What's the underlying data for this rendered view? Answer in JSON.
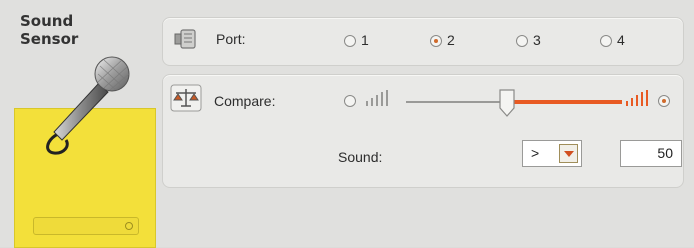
{
  "sensor": {
    "title": "Sound\nSensor",
    "icon": "microphone-icon",
    "color": "#f3e03a"
  },
  "port": {
    "label": "Port:",
    "icon": "sensor-port-icon",
    "options": [
      "1",
      "2",
      "3",
      "4"
    ],
    "selected": "2"
  },
  "compare": {
    "label": "Compare:",
    "icon": "scale-compare-icon",
    "left_radio_selected": false,
    "right_radio_selected": true,
    "slider_value_fraction": 0.48,
    "accent_color": "#e85a23"
  },
  "sound": {
    "label": "Sound:",
    "operator": ">",
    "value": "50"
  }
}
